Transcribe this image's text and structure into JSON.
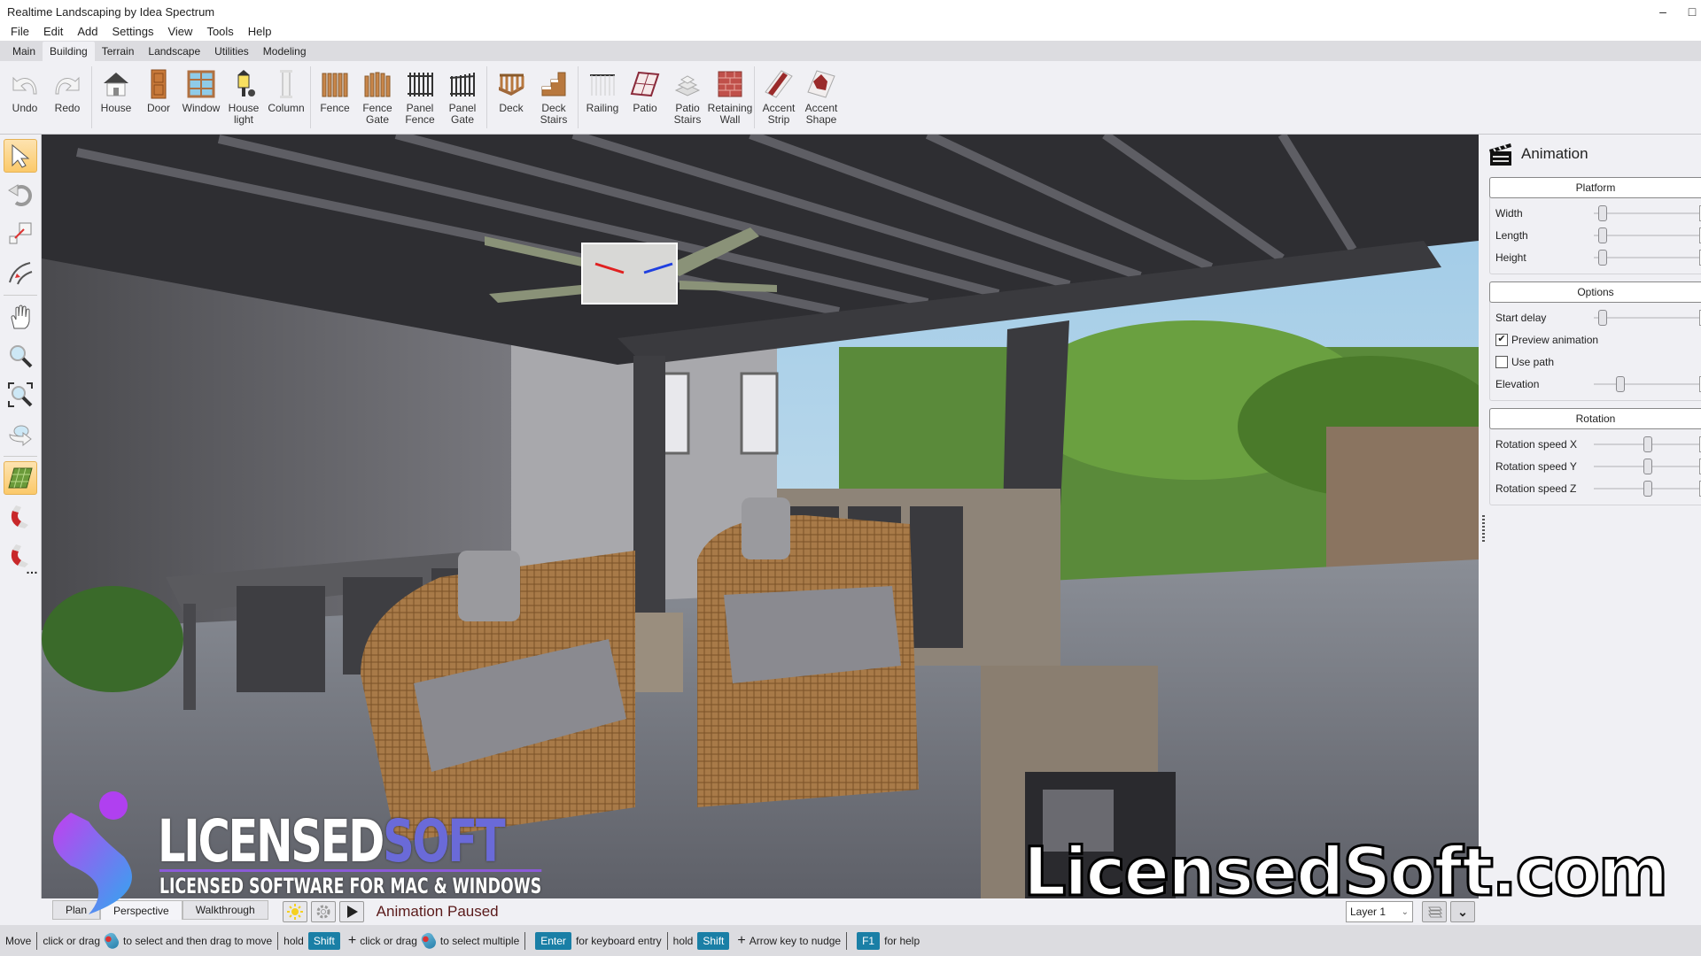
{
  "window": {
    "title": "Realtime Landscaping  by Idea Spectrum",
    "minimize_icon": "minimize-icon",
    "restore_icon": "restore-icon"
  },
  "menu": [
    "File",
    "Edit",
    "Add",
    "Settings",
    "View",
    "Tools",
    "Help"
  ],
  "tabs": [
    {
      "label": "Main",
      "active": false
    },
    {
      "label": "Building",
      "active": true
    },
    {
      "label": "Terrain",
      "active": false
    },
    {
      "label": "Landscape",
      "active": false
    },
    {
      "label": "Utilities",
      "active": false
    },
    {
      "label": "Modeling",
      "active": false
    }
  ],
  "ribbon": {
    "undo": {
      "label": "Undo",
      "icon": "undo-icon"
    },
    "redo": {
      "label": "Redo",
      "icon": "redo-icon"
    },
    "house": {
      "label": "House",
      "icon": "house-icon"
    },
    "door": {
      "label": "Door",
      "icon": "door-icon"
    },
    "window": {
      "label": "Window",
      "icon": "window-icon"
    },
    "house_light": {
      "label": "House light",
      "icon": "lamp-icon"
    },
    "column": {
      "label": "Column",
      "icon": "column-icon"
    },
    "fence": {
      "label": "Fence",
      "icon": "fence-icon"
    },
    "fence_gate": {
      "label": "Fence Gate",
      "icon": "fence-gate-icon"
    },
    "panel_fence": {
      "label": "Panel Fence",
      "icon": "panel-fence-icon"
    },
    "panel_gate": {
      "label": "Panel Gate",
      "icon": "panel-gate-icon"
    },
    "deck": {
      "label": "Deck",
      "icon": "deck-icon"
    },
    "deck_stairs": {
      "label": "Deck Stairs",
      "icon": "deck-stairs-icon"
    },
    "railing": {
      "label": "Railing",
      "icon": "railing-icon"
    },
    "patio": {
      "label": "Patio",
      "icon": "patio-icon"
    },
    "patio_stairs": {
      "label": "Patio Stairs",
      "icon": "patio-stairs-icon"
    },
    "retaining_wall": {
      "label": "Retaining Wall",
      "icon": "retaining-wall-icon"
    },
    "accent_strip": {
      "label": "Accent Strip",
      "icon": "accent-strip-icon"
    },
    "accent_shape": {
      "label": "Accent Shape",
      "icon": "accent-shape-icon"
    }
  },
  "left_tools": [
    "select-arrow-icon",
    "rotate-icon",
    "resize-icon",
    "curve-icon",
    "pan-hand-icon",
    "zoom-icon",
    "zoom-extents-icon",
    "orbit-icon",
    "grid-snap-icon",
    "magnet-icon",
    "magnet-options-icon"
  ],
  "panel": {
    "title": "Animation",
    "icon": "clapperboard-icon",
    "platform": {
      "header": "Platform",
      "rows": [
        {
          "label": "Width",
          "value": 0.08
        },
        {
          "label": "Length",
          "value": 0.08
        },
        {
          "label": "Height",
          "value": 0.08
        }
      ]
    },
    "options": {
      "header": "Options",
      "start_delay": {
        "label": "Start delay",
        "value": 0.08
      },
      "preview_animation": {
        "label": "Preview animation",
        "checked": true
      },
      "use_path": {
        "label": "Use path",
        "checked": false
      },
      "elevation": {
        "label": "Elevation",
        "value": 0.25
      }
    },
    "rotation": {
      "header": "Rotation",
      "rows": [
        {
          "label": "Rotation speed X",
          "value": 0.5
        },
        {
          "label": "Rotation speed Y",
          "value": 0.5
        },
        {
          "label": "Rotation speed Z",
          "value": 0.5
        }
      ]
    }
  },
  "viewbar": {
    "tabs": [
      {
        "label": "Plan",
        "active": false
      },
      {
        "label": "Perspective",
        "active": true
      },
      {
        "label": "Walkthrough",
        "active": false
      }
    ],
    "sun_icon": "sun-icon",
    "settings_icon": "gear-icon",
    "play_icon": "play-icon",
    "animation_status": "Animation Paused",
    "layer": "Layer 1",
    "layers_icon": "layers-icon",
    "expand_icon": "chevron-down-icon"
  },
  "status": {
    "mode": "Move",
    "t1": "click or drag",
    "t2": "to select and then drag to move",
    "t3": "hold",
    "key_shift": "Shift",
    "t4": "click or drag",
    "t5": "to select multiple",
    "key_enter": "Enter",
    "t6": "for keyboard entry",
    "t7": "hold",
    "key_shift2": "Shift",
    "t8": "Arrow key to nudge",
    "key_f1": "F1",
    "t9": "for help"
  },
  "watermark": {
    "brand_a": "LICENSED",
    "brand_b": "SOFT",
    "tagline": "LICENSED SOFTWARE FOR MAC & WINDOWS",
    "url": "LicensedSoft.com"
  }
}
